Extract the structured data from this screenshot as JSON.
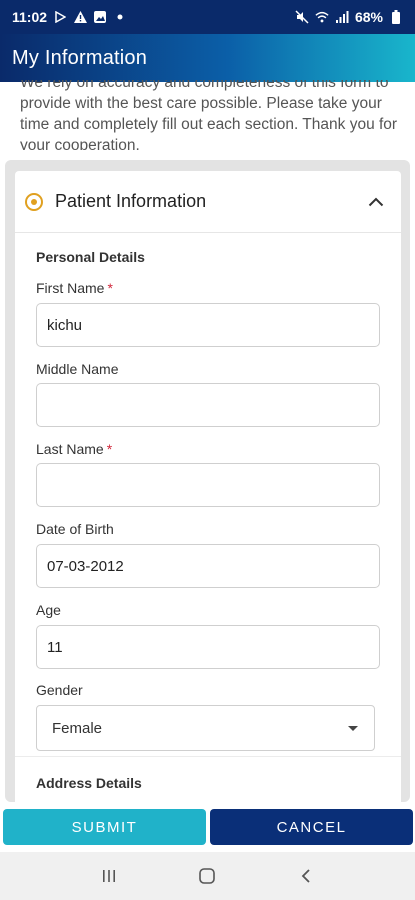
{
  "status_bar": {
    "time": "11:02",
    "battery": "68%"
  },
  "app_bar": {
    "title": "My Information"
  },
  "intro": {
    "text": "We rely on accuracy and completeness of this form to provide with the best care possible. Please take your time and completely fill out each section. Thank you for your cooperation."
  },
  "section": {
    "title": "Patient Information",
    "personal_details_heading": "Personal Details",
    "fields": {
      "first_name": {
        "label": "First Name",
        "required": "*",
        "value": "kichu"
      },
      "middle_name": {
        "label": "Middle Name",
        "value": ""
      },
      "last_name": {
        "label": "Last Name",
        "required": "*",
        "value": ""
      },
      "dob": {
        "label": "Date of Birth",
        "value": "07-03-2012"
      },
      "age": {
        "label": "Age",
        "value": "11"
      },
      "gender": {
        "label": "Gender",
        "value": "Female"
      }
    },
    "address_details_heading": "Address Details"
  },
  "buttons": {
    "submit": "SUBMIT",
    "cancel": "CANCEL"
  },
  "colors": {
    "accent": "#20b2c9",
    "primary_dark": "#0a2f78",
    "required": "#d0263a",
    "radio": "#e0a020"
  }
}
